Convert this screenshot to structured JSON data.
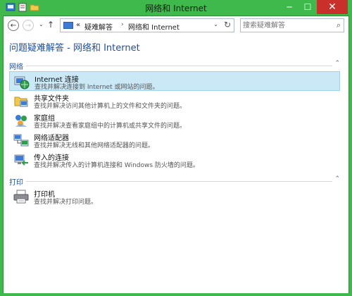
{
  "window": {
    "title": "网络和 Internet",
    "minimize": "─",
    "maximize": "☐",
    "close": "✕"
  },
  "nav": {
    "back": "←",
    "forward": "→",
    "dropdown": "⌄",
    "up": "↑",
    "breadcrumb": {
      "overflow": "«",
      "crumb1": "疑难解答",
      "sep": "›",
      "crumb2": "网络和 Internet"
    },
    "address_dropdown": "⌄",
    "refresh": "↻",
    "search_placeholder": "搜索疑难解答",
    "search_icon": "⌕"
  },
  "page_title": "问题疑难解答 - 网络和 Internet",
  "groups": [
    {
      "name": "网络",
      "chevron": "⌃",
      "items": [
        {
          "title": "Internet 连接",
          "desc": "查找并解决连接到 Internet 或网站的问题。",
          "icon": "internet-icon",
          "selected": true
        },
        {
          "title": "共享文件夹",
          "desc": "查找并解决访问其他计算机上的文件和文件夹的问题。",
          "icon": "shared-folder-icon",
          "selected": false
        },
        {
          "title": "家庭组",
          "desc": "查找并解决查看家庭组中的计算机或共享文件的问题。",
          "icon": "homegroup-icon",
          "selected": false
        },
        {
          "title": "网络适配器",
          "desc": "查找并解决无线和其他网络适配器的问题。",
          "icon": "network-adapter-icon",
          "selected": false
        },
        {
          "title": "传入的连接",
          "desc": "查找并解决传入的计算机连接和 Windows 防火墙的问题。",
          "icon": "incoming-connections-icon",
          "selected": false
        }
      ]
    },
    {
      "name": "打印",
      "chevron": "⌃",
      "items": [
        {
          "title": "打印机",
          "desc": "查找并解决打印问题。",
          "icon": "printer-icon",
          "selected": false
        }
      ]
    }
  ]
}
